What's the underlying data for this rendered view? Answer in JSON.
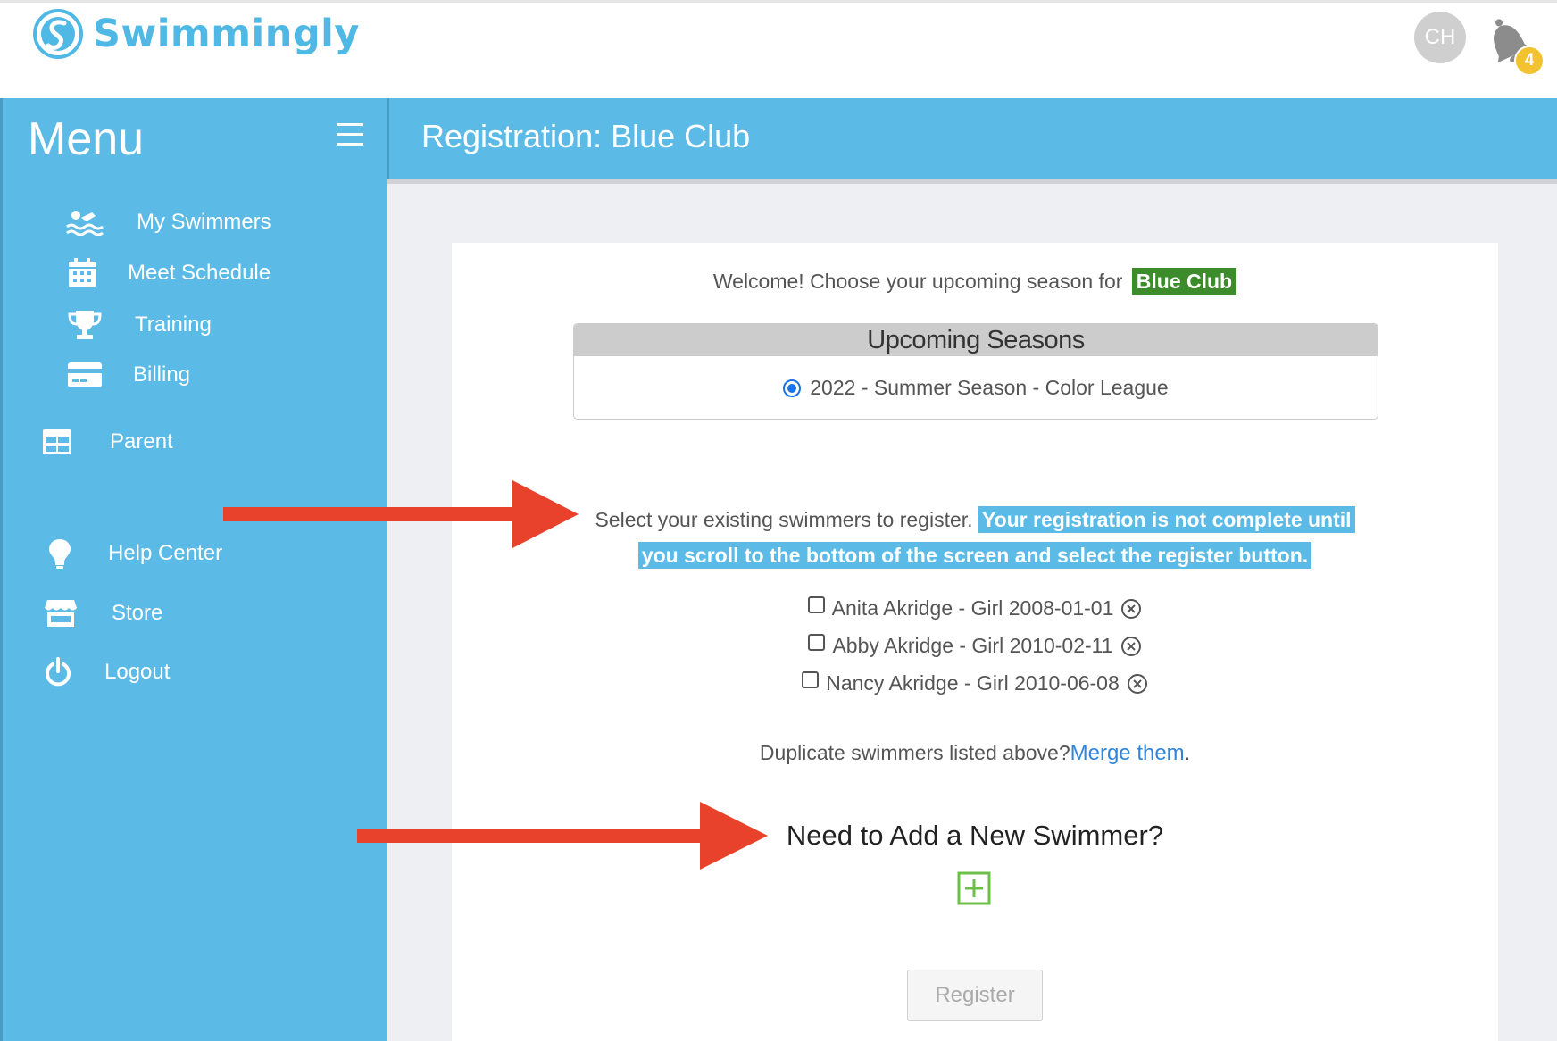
{
  "app": {
    "logo_text": "Swimmingly",
    "avatar_initials": "CH",
    "notification_count": "4"
  },
  "sidebar": {
    "title": "Menu",
    "items": [
      {
        "label": "My Swimmers",
        "icon": "swimmer-icon"
      },
      {
        "label": "Meet Schedule",
        "icon": "calendar-icon"
      },
      {
        "label": "Training",
        "icon": "trophy-icon"
      },
      {
        "label": "Billing",
        "icon": "credit-card-icon"
      },
      {
        "label": "Parent",
        "icon": "grid-icon"
      },
      {
        "label": "Help Center",
        "icon": "lightbulb-icon"
      },
      {
        "label": "Store",
        "icon": "store-icon"
      },
      {
        "label": "Logout",
        "icon": "power-icon"
      }
    ]
  },
  "header": {
    "title": "Registration: Blue Club"
  },
  "registration": {
    "welcome_text": "Welcome! Choose your upcoming season for",
    "club_name": "Blue Club",
    "seasons_heading": "Upcoming Seasons",
    "season_option": "2022 - Summer Season - Color League",
    "select_text": "Select your existing swimmers to register.",
    "notice_line1": "Your registration is not complete until",
    "notice_line2": "you scroll to the bottom of the screen and select the register button.",
    "swimmers": [
      {
        "label": "Anita Akridge - Girl 2008-01-01"
      },
      {
        "label": "Abby Akridge - Girl 2010-02-11"
      },
      {
        "label": "Nancy Akridge - Girl 2010-06-08"
      }
    ],
    "duplicate_text": "Duplicate swimmers listed above?",
    "merge_link": "Merge them",
    "merge_suffix": ".",
    "new_swimmer_heading": "Need to Add a New Swimmer?",
    "register_label": "Register"
  },
  "colors": {
    "brand_blue": "#5bbbe6",
    "club_green": "#3c8c2c",
    "link_blue": "#2f86d9",
    "annotation_red": "#e8412c",
    "plus_green": "#6cc04a"
  }
}
